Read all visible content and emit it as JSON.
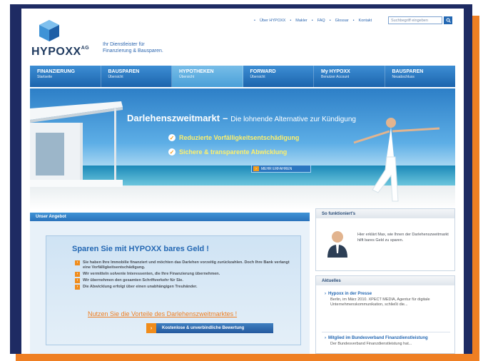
{
  "header": {
    "logo_text": "HYPOXX",
    "logo_sup": "AG",
    "tagline_line1": "Ihr Dienstleister für",
    "tagline_line2": "Finanzierung & Bausparen.",
    "top_links": [
      "Über HYPOXX",
      "Makler",
      "FAQ",
      "Glossar",
      "Kontakt"
    ],
    "search_placeholder": "Suchbegriff eingeben"
  },
  "nav": [
    {
      "title": "FINANZIERUNG",
      "sub": "Startseite"
    },
    {
      "title": "BAUSPAREN",
      "sub": "Übersicht"
    },
    {
      "title": "HYPOTHEKEN",
      "sub": "Übersicht"
    },
    {
      "title": "FORWARD",
      "sub": "Übersicht"
    },
    {
      "title": "My HYPOXX",
      "sub": "Benutzer Account"
    },
    {
      "title": "BAUSPAREN",
      "sub": "Neuabschluss"
    }
  ],
  "hero": {
    "title": "Darlehenszweitmarkt",
    "dash": "–",
    "subtitle": "Die lohnende Alternative zur Kündigung",
    "bullet1": "Reduzierte Vorfälligkeitsentschädigung",
    "bullet2": "Sichere & transparente Abwicklung",
    "button": "MEHR ERFAHREN"
  },
  "offer": {
    "header": "Unser Angebot",
    "title": "Sparen Sie mit HYPOXX bares Geld !",
    "items": [
      "Sie haben Ihre Immobilie finanziert und möchten das Darlehen vorzeitig zurückzahlen. Doch Ihre Bank verlangt eine Vorfälligkeitsentschädigung.",
      "Wir vermitteln solvente Interessenten, die Ihre Finanzierung übernehmen.",
      "Wir übernehmen den gesamten Schriftverkehr für Sie.",
      "Die Abwicklung erfolgt über einen unabhängigen Treuhänder."
    ],
    "link": "Nutzen Sie die Vorteile des Darlehenszweitmarktes !",
    "cta": "Kostenlose & unverbindliche Bewertung"
  },
  "how": {
    "header": "So funktioniert's",
    "text": "Hier erklärt Max, wie Ihnen der Darlehenszweitmarkt hilft bares Geld zu sparen."
  },
  "news": {
    "header": "Aktuelles",
    "items": [
      {
        "title": "Hypoxx in der Presse",
        "text": "Berlin, im März 2010. XPECT MEDIA, Agentur für digitale Unternehmenskommunikation, schließt die..."
      },
      {
        "title": "Mitglied im Bundesverband Finanzdienstleistung",
        "text": "Der Bundesverband Finanzdienstleistung hat..."
      }
    ]
  },
  "colors": {
    "frame": "#1e2b63",
    "accent_orange": "#ef7f23",
    "brand_blue": "#2468b3"
  }
}
